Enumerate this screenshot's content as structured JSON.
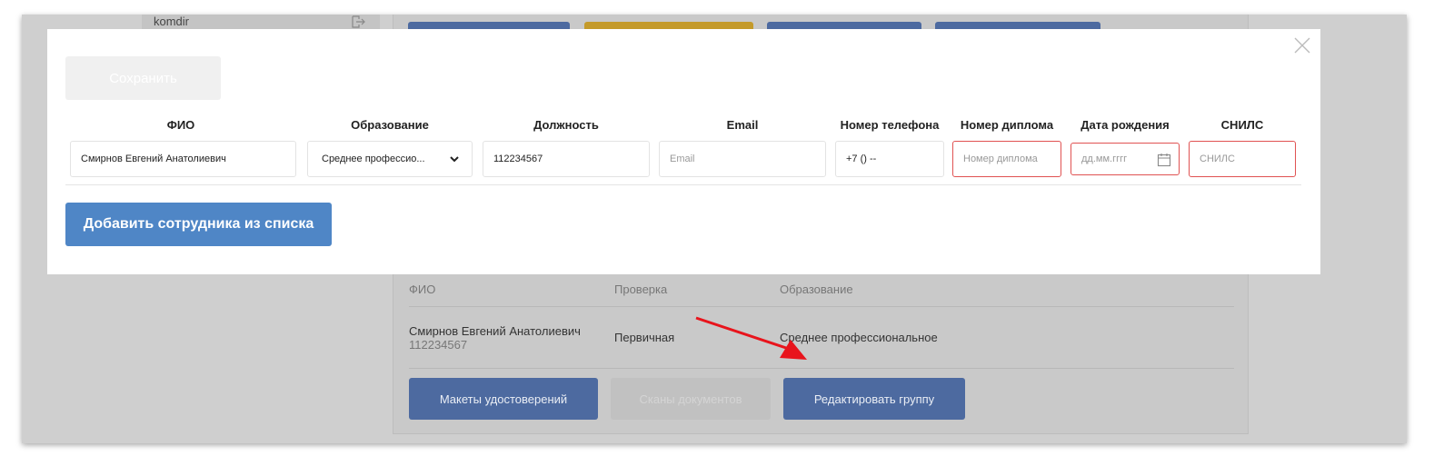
{
  "background": {
    "user_name": "komdir",
    "top_buttons_colors": [
      "#4d6aa0",
      "#c49a2a",
      "#4d6aa0",
      "#4d6aa0"
    ],
    "employees_table": {
      "headers": [
        "ФИО",
        "Проверка",
        "Образование"
      ],
      "rows": [
        {
          "name": "Смирнов Евгений Анатолиевич",
          "position": "112234567",
          "check": "Первичная",
          "education": "Среднее профессиональное"
        }
      ]
    },
    "buttons": {
      "certificates": "Макеты удостоверений",
      "scans": "Сканы документов",
      "edit_group": "Редактировать группу"
    }
  },
  "modal": {
    "save_label": "Сохранить",
    "columns": [
      "ФИО",
      "Образование",
      "Должность",
      "Email",
      "Номер телефона",
      "Номер диплома",
      "Дата рождения",
      "СНИЛС"
    ],
    "row": {
      "fio": "Смирнов Евгений Анатолиевич",
      "education": "Среднее профессио...",
      "position": "112234567",
      "email_placeholder": "Email",
      "phone": "+7 () --",
      "diploma_placeholder": "Номер диплома",
      "birthdate_placeholder": "дд.мм.гггг",
      "snils_placeholder": "СНИЛС"
    },
    "add_button_label": "Добавить сотрудника из списка"
  },
  "colors": {
    "error_border": "#e05252",
    "primary": "#4f86c6"
  }
}
